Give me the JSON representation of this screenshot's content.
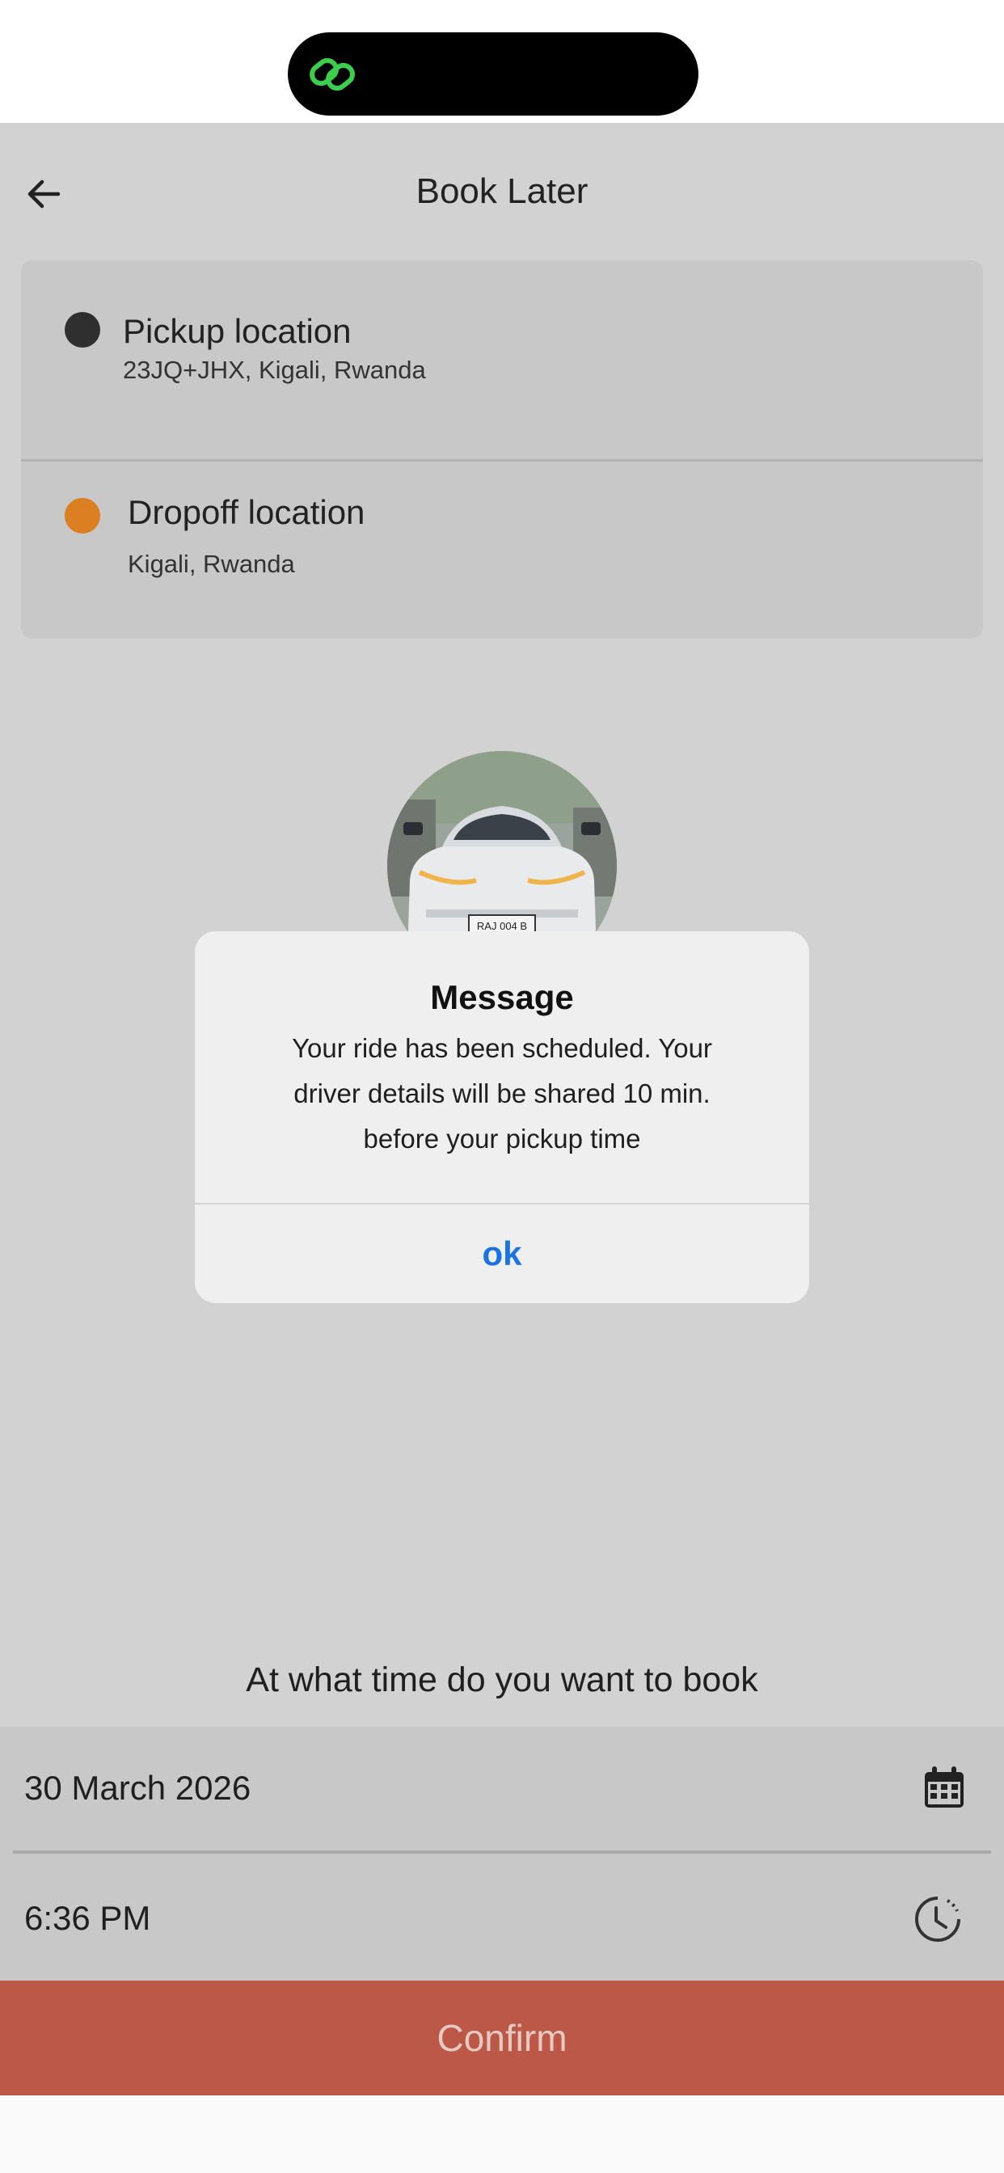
{
  "header": {
    "title": "Book Later"
  },
  "pickup": {
    "label": "Pickup location",
    "address": "23JQ+JHX, Kigali, Rwanda"
  },
  "dropoff": {
    "label": "Dropoff location",
    "address": "Kigali, Rwanda"
  },
  "car": {
    "plate": "RAJ 004 B"
  },
  "dialog": {
    "title": "Message",
    "lines": [
      "Your ride has been scheduled. Your",
      "driver details will be shared 10 min.",
      "before your pickup time"
    ],
    "ok_label": "ok"
  },
  "booking": {
    "question": "At what time do you want to book",
    "date": "30 March 2026",
    "time": "6:36 PM",
    "confirm_label": "Confirm"
  },
  "colors": {
    "overlay_background": "#d2d2d2",
    "dropoff_dot": "#dc7e22",
    "pickup_dot": "#2f2f2f",
    "confirm_button": "#bb5847",
    "dialog_action": "#1a73e0",
    "island_icon": "#3ccf4e"
  }
}
